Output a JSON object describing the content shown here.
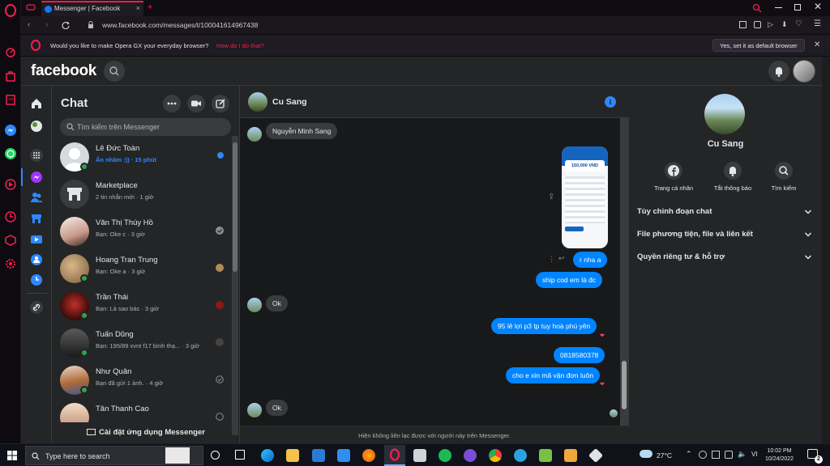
{
  "browser": {
    "tab_title": "Messenger | Facebook",
    "tab_close": "×",
    "new_tab": "+",
    "url": "www.facebook.com/messages/t/100041614967438",
    "infobar_message": "Would you like to make Opera GX your everyday browser?",
    "infobar_link": "How do I do that?",
    "infobar_button": "Yes, set it as default browser"
  },
  "fb": {
    "logo": "facebook"
  },
  "chatlist": {
    "title": "Chat",
    "search_placeholder": "Tìm kiếm trên Messenger",
    "install_label": "Cài đặt ứng dụng Messenger",
    "items": [
      {
        "name": "Lê Đức Toàn",
        "preview": "Ẩn nhầm :)) · 15 phút"
      },
      {
        "name": "Marketplace",
        "preview": "2 tin nhắn mới · 1 giờ"
      },
      {
        "name": "Văn Thị Thúy Hồ",
        "preview": "Bạn: Oke c · 3 giờ"
      },
      {
        "name": "Hoang Tran Trung",
        "preview": "Bạn: Oke a · 3 giờ"
      },
      {
        "name": "Trần Thái",
        "preview": "Bạn: Là sao bác · 3 giờ"
      },
      {
        "name": "Tuấn Dũng",
        "preview": "Bạn: 195/89 xvnt f17 bình thạ...  · 3 giờ"
      },
      {
        "name": "Như Quân",
        "preview": "Bạn đã gửi 1 ảnh. · 4 giờ"
      },
      {
        "name": "Tân Thanh Cao",
        "preview": ""
      }
    ]
  },
  "conversation": {
    "contact_name": "Cu Sang",
    "footer": "Hiện không liên lạc được với người này trên Messenger.",
    "image_price": "150,000 VND",
    "messages": [
      {
        "dir": "in",
        "text": "Nguyễn Minh Sang"
      },
      {
        "dir": "out",
        "text": "r nha a"
      },
      {
        "dir": "out",
        "text": "ship cod em là đc"
      },
      {
        "dir": "in",
        "text": "Ok"
      },
      {
        "dir": "out",
        "text": "95 lê lợi p3 tp tuy hoà phú yên"
      },
      {
        "dir": "out",
        "text": "0818580378"
      },
      {
        "dir": "out",
        "text": "cho e xin mã vận đơn luôn"
      },
      {
        "dir": "in",
        "text": "Ok"
      }
    ]
  },
  "info_panel": {
    "name": "Cu Sang",
    "actions": [
      {
        "label": "Trang cá nhân",
        "icon": "facebook-icon"
      },
      {
        "label": "Tắt thông báo",
        "icon": "bell-icon"
      },
      {
        "label": "Tìm kiếm",
        "icon": "search-icon"
      }
    ],
    "sections": [
      {
        "label": "Tùy chỉnh đoạn chat"
      },
      {
        "label": "File phương tiện, file và liên kết"
      },
      {
        "label": "Quyền riêng tư & hỗ trợ"
      }
    ]
  },
  "taskbar": {
    "search_placeholder": "Type here to search",
    "weather": "27°C",
    "time": "10:02 PM",
    "date": "10/24/2022",
    "notifications": "2"
  },
  "colors": {
    "accent": "#fa1e4e",
    "messenger_blue": "#0084ff",
    "online": "#31a24c"
  }
}
